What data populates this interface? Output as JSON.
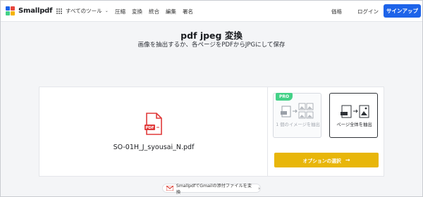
{
  "brand": {
    "name": "Smallpdf",
    "logo_colors": [
      "#1d63e9",
      "#e8453c",
      "#44d187",
      "#f5b400"
    ]
  },
  "nav": {
    "all_tools": "すべてのツール",
    "links": [
      "圧縮",
      "変換",
      "統合",
      "編集",
      "署名"
    ],
    "pricing": "価格",
    "login": "ログイン",
    "signup": "サインアップ"
  },
  "page": {
    "title": "pdf jpeg 変換",
    "subtitle": "画像を抽出するか、各ページをPDFからJPGにして保存"
  },
  "file": {
    "name": "SO-01H_J_syousai_N.pdf",
    "icon": "pdf-file-icon",
    "icon_color": "#e03a3a"
  },
  "options": {
    "extract_images": {
      "badge": "PRO",
      "label": "1 個のイメージを抽出",
      "disabled": true
    },
    "convert_pages": {
      "label": "ページ全体を抽出",
      "selected": true
    }
  },
  "choose_button": {
    "label": "オプションの選択",
    "color": "#e8b60a"
  },
  "gmail_promo": {
    "label": "SmallpdfでGmailの添付ファイルを変換"
  },
  "colors": {
    "primary": "#1d63e9",
    "pro_badge": "#44d187"
  }
}
